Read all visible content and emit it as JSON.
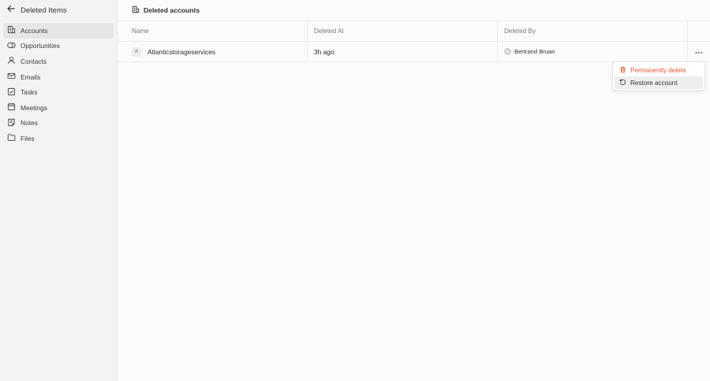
{
  "sidebar": {
    "back_title": "Deleted Items",
    "items": [
      {
        "label": "Accounts",
        "icon": "building-icon",
        "active": true
      },
      {
        "label": "Opportunities",
        "icon": "coins-icon"
      },
      {
        "label": "Contacts",
        "icon": "user-icon"
      },
      {
        "label": "Emails",
        "icon": "mail-icon"
      },
      {
        "label": "Tasks",
        "icon": "checkbox-icon"
      },
      {
        "label": "Meetings",
        "icon": "calendar-icon"
      },
      {
        "label": "Notes",
        "icon": "note-icon"
      },
      {
        "label": "Files",
        "icon": "folder-icon"
      }
    ]
  },
  "header": {
    "title": "Deleted accounts",
    "icon": "building-icon"
  },
  "table": {
    "columns": [
      "Name",
      "Deleted At",
      "Deleted By"
    ],
    "rows": [
      {
        "avatar": "A",
        "name": "Atlanticstorageservices",
        "deleted_at": "3h ago",
        "deleted_by_initials": "BB",
        "deleted_by": "Bertrand Bruan"
      }
    ]
  },
  "row_menu": {
    "items": [
      {
        "label": "Permanently delete",
        "icon": "trash-icon",
        "color": "#e5532d"
      },
      {
        "label": "Restore account",
        "icon": "restore-icon"
      }
    ]
  },
  "colors": {
    "danger": "#e5532d",
    "sidebar_bg": "#f3f3f3",
    "active_item_bg": "#e6e6e6"
  }
}
